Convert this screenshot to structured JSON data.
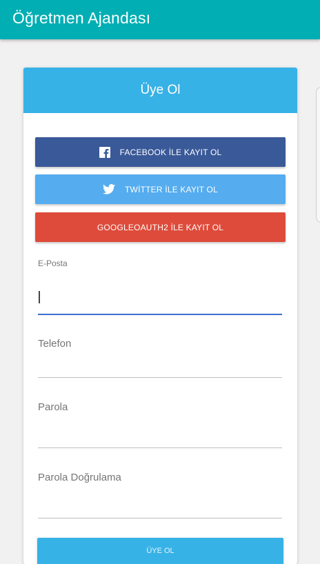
{
  "app": {
    "title": "Öğretmen Ajandası",
    "bar_color": "#00aeb3"
  },
  "card": {
    "header_title": "Üye Ol",
    "header_color": "#37b2e6"
  },
  "social": {
    "facebook": {
      "label": "FACEBOOK İLE KAYIT OL",
      "icon": "facebook-icon",
      "color": "#3a5998"
    },
    "twitter": {
      "label": "TWİTTER İLE KAYIT OL",
      "icon": "twitter-icon",
      "color": "#55acee"
    },
    "google": {
      "label": "GOOGLEOAUTH2 İLE KAYIT OL",
      "color": "#de4b3b"
    }
  },
  "form": {
    "email": {
      "label": "E-Posta",
      "value": ""
    },
    "phone": {
      "label": "Telefon",
      "value": ""
    },
    "password": {
      "label": "Parola",
      "value": ""
    },
    "password_confirm": {
      "label": "Parola Doğrulama",
      "value": ""
    },
    "submit_label": "ÜYE OL"
  }
}
